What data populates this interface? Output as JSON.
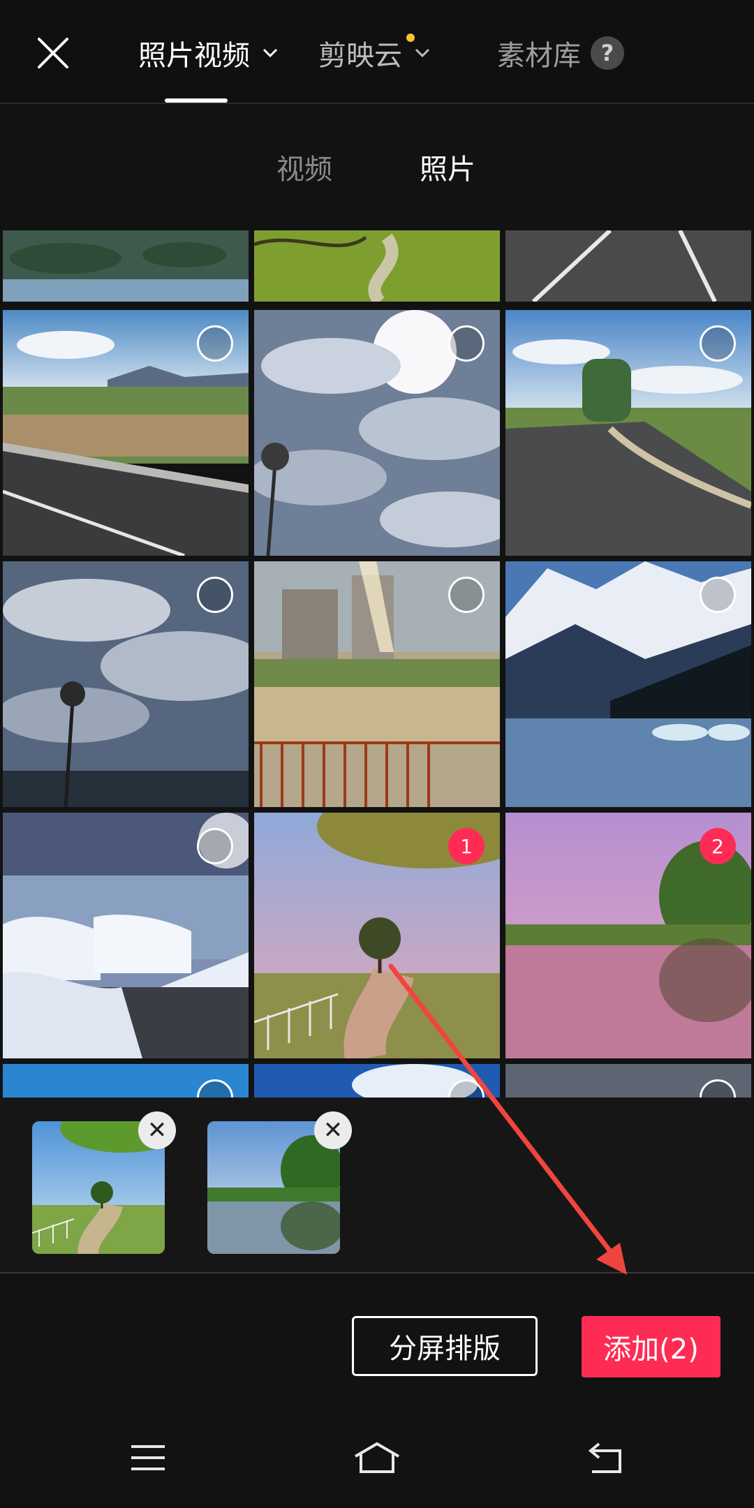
{
  "header": {
    "tabs": [
      {
        "label": "照片视频"
      },
      {
        "label": "剪映云"
      },
      {
        "label": "素材库"
      }
    ],
    "help_label": "?"
  },
  "subtabs": {
    "video": "视频",
    "photo": "照片"
  },
  "grid": {
    "selected": [
      {
        "index": 1
      },
      {
        "index": 2
      }
    ],
    "selected_numbers": [
      "1",
      "2"
    ]
  },
  "tray": {
    "remove_label": "✕"
  },
  "actions": {
    "split_label": "分屏排版",
    "add_label": "添加(2)"
  },
  "colors": {
    "accent": "#fe2c55",
    "notification_dot": "#f4c531",
    "background": "#121212"
  }
}
